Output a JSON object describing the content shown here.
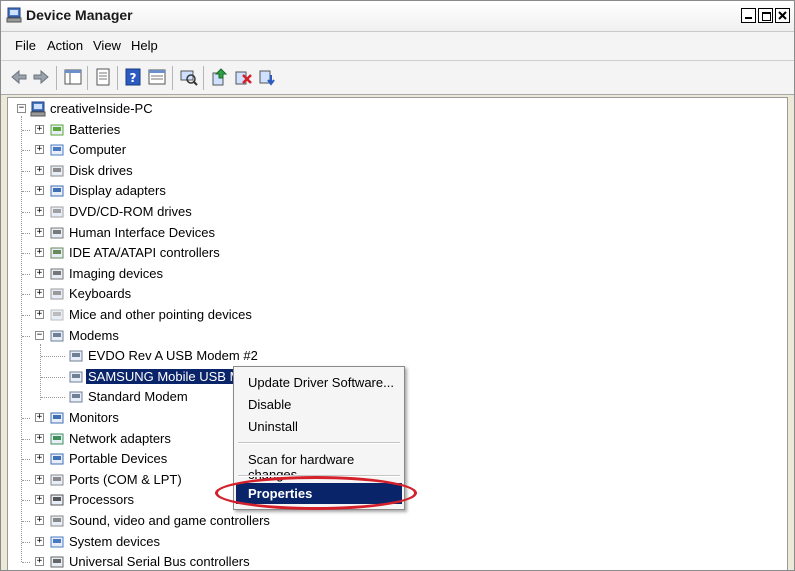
{
  "window": {
    "title": "Device Manager"
  },
  "menu": [
    "File",
    "Action",
    "View",
    "Help"
  ],
  "toolbar_icons": [
    "back-icon",
    "forward-icon",
    "show-hide-tree-icon",
    "properties-icon",
    "help-icon",
    "view-icon",
    "scan-hardware-icon",
    "update-driver-icon",
    "uninstall-icon",
    "disable-icon"
  ],
  "tree": {
    "root": "creativeInside-PC",
    "categories": [
      {
        "label": "Batteries",
        "icon": "battery-icon"
      },
      {
        "label": "Computer",
        "icon": "computer-icon"
      },
      {
        "label": "Disk drives",
        "icon": "disk-drive-icon"
      },
      {
        "label": "Display adapters",
        "icon": "display-adapter-icon"
      },
      {
        "label": "DVD/CD-ROM drives",
        "icon": "dvd-drive-icon"
      },
      {
        "label": "Human Interface Devices",
        "icon": "hid-icon"
      },
      {
        "label": "IDE ATA/ATAPI controllers",
        "icon": "ide-controller-icon"
      },
      {
        "label": "Imaging devices",
        "icon": "imaging-device-icon"
      },
      {
        "label": "Keyboards",
        "icon": "keyboard-icon"
      },
      {
        "label": "Mice and other pointing devices",
        "icon": "mouse-icon"
      },
      {
        "label": "Modems",
        "icon": "modem-icon",
        "expanded": true,
        "children": [
          {
            "label": "EVDO Rev A USB Modem #2",
            "icon": "modem-icon"
          },
          {
            "label": "SAMSUNG Mobile USB Modem",
            "icon": "modem-icon",
            "selected": true
          },
          {
            "label": "Standard Modem",
            "icon": "standard-modem-icon"
          }
        ]
      },
      {
        "label": "Monitors",
        "icon": "monitor-icon"
      },
      {
        "label": "Network adapters",
        "icon": "network-adapter-icon"
      },
      {
        "label": "Portable Devices",
        "icon": "portable-device-icon"
      },
      {
        "label": "Ports (COM & LPT)",
        "icon": "port-icon"
      },
      {
        "label": "Processors",
        "icon": "processor-icon"
      },
      {
        "label": "Sound, video and game controllers",
        "icon": "sound-icon"
      },
      {
        "label": "System devices",
        "icon": "system-device-icon"
      },
      {
        "label": "Universal Serial Bus controllers",
        "icon": "usb-icon"
      }
    ]
  },
  "context_menu": {
    "items": [
      "Update Driver Software...",
      "Disable",
      "Uninstall",
      "Scan for hardware changes",
      "Properties"
    ],
    "highlighted": "Properties"
  },
  "colors": {
    "selection": "#0a246a",
    "annotation": "#d4202a"
  }
}
